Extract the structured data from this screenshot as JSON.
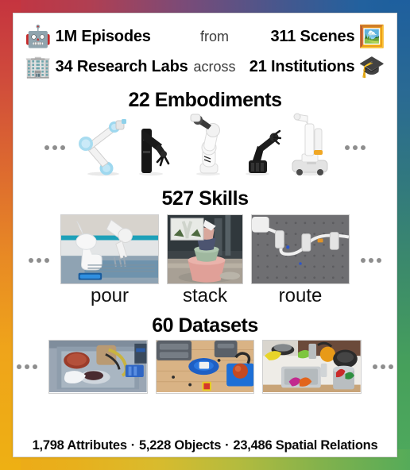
{
  "frame": {
    "gradient_start": "#c5343f",
    "gradient_mid_top": "#1e5f9e",
    "gradient_mid_bottom": "#4faa5d",
    "gradient_end": "#eeb013"
  },
  "stats": {
    "rows": [
      {
        "icon": "robot-emoji",
        "icon_glyph": "🤖",
        "primary": "1M Episodes",
        "connector": "from",
        "secondary": "311 Scenes",
        "secondary_icon": "framed-picture-emoji",
        "secondary_icon_glyph": "🖼️"
      },
      {
        "icon": "office-building-emoji",
        "icon_glyph": "🏢",
        "primary": "34 Research Labs",
        "connector": "across",
        "secondary": "21 Institutions",
        "secondary_icon": "graduation-cap-emoji",
        "secondary_icon_glyph": "🎓"
      }
    ]
  },
  "sections": {
    "embodiments": {
      "title": "22 Embodiments",
      "items": [
        {
          "name": "ur-style-arm"
        },
        {
          "name": "black-articulated-arm"
        },
        {
          "name": "franka-panda-arm"
        },
        {
          "name": "industrial-black-arm"
        },
        {
          "name": "mobile-manipulator"
        }
      ]
    },
    "skills": {
      "title": "527 Skills",
      "items": [
        {
          "label": "pour",
          "thumb": "robot-arm-pouring-on-blue-table"
        },
        {
          "label": "stack",
          "thumb": "robot-stacking-pink-bowls-with-inset"
        },
        {
          "label": "route",
          "thumb": "cable-routing-on-pegboard"
        }
      ]
    },
    "datasets": {
      "title": "60 Datasets",
      "items": [
        {
          "thumb": "scooping-beans-in-bin"
        },
        {
          "thumb": "wooden-table-blue-bowl-tomato"
        },
        {
          "thumb": "kitchen-sink-with-toy-food"
        }
      ]
    }
  },
  "footer": {
    "attributes": "1,798 Attributes",
    "separator": "·",
    "objects": "5,228 Objects",
    "relations": "23,486 Spatial Relations"
  }
}
